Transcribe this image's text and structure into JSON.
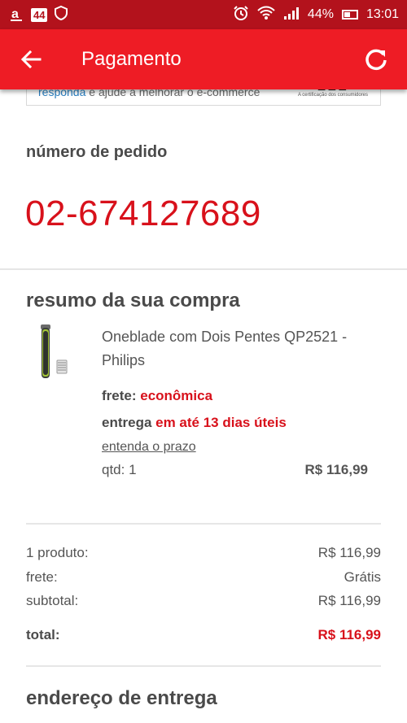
{
  "status_bar": {
    "left_icons": [
      "amazon-icon",
      "badge-44-icon",
      "shield-icon"
    ],
    "badge": "44",
    "right_icons": [
      "alarm-icon",
      "wifi-icon",
      "signal-icon",
      "battery-icon"
    ],
    "battery": "44%",
    "time": "13:01"
  },
  "app_bar": {
    "title": "Pagamento",
    "back_icon": "arrow-back-icon",
    "refresh_icon": "refresh-icon"
  },
  "survey": {
    "link_text": "responda",
    "text": " e ajude a melhorar o e-commerce",
    "caption": "A certificação dos consumidores"
  },
  "order": {
    "label": "número de pedido",
    "number": "02-674127689"
  },
  "summary": {
    "title": "resumo da sua compra",
    "product": {
      "name": "Oneblade com Dois Pentes QP2521 - Philips",
      "freight_label": "frete: ",
      "freight_value": "econômica",
      "delivery_label": "entrega ",
      "delivery_value": "em até 13 dias úteis",
      "deadline_link": "entenda o prazo",
      "qty": "qtd: 1",
      "price": "R$ 116,99"
    }
  },
  "totals": [
    {
      "label": "1 produto:",
      "value": "R$ 116,99"
    },
    {
      "label": "frete:",
      "value": "Grátis"
    },
    {
      "label": "subtotal:",
      "value": "R$ 116,99"
    }
  ],
  "total": {
    "label": "total:",
    "value": "R$ 116,99"
  },
  "address": {
    "title": "endereço de entrega"
  },
  "colors": {
    "brand_red": "#ee1c25",
    "status_red": "#b3121c",
    "accent_red": "#d8111b"
  }
}
